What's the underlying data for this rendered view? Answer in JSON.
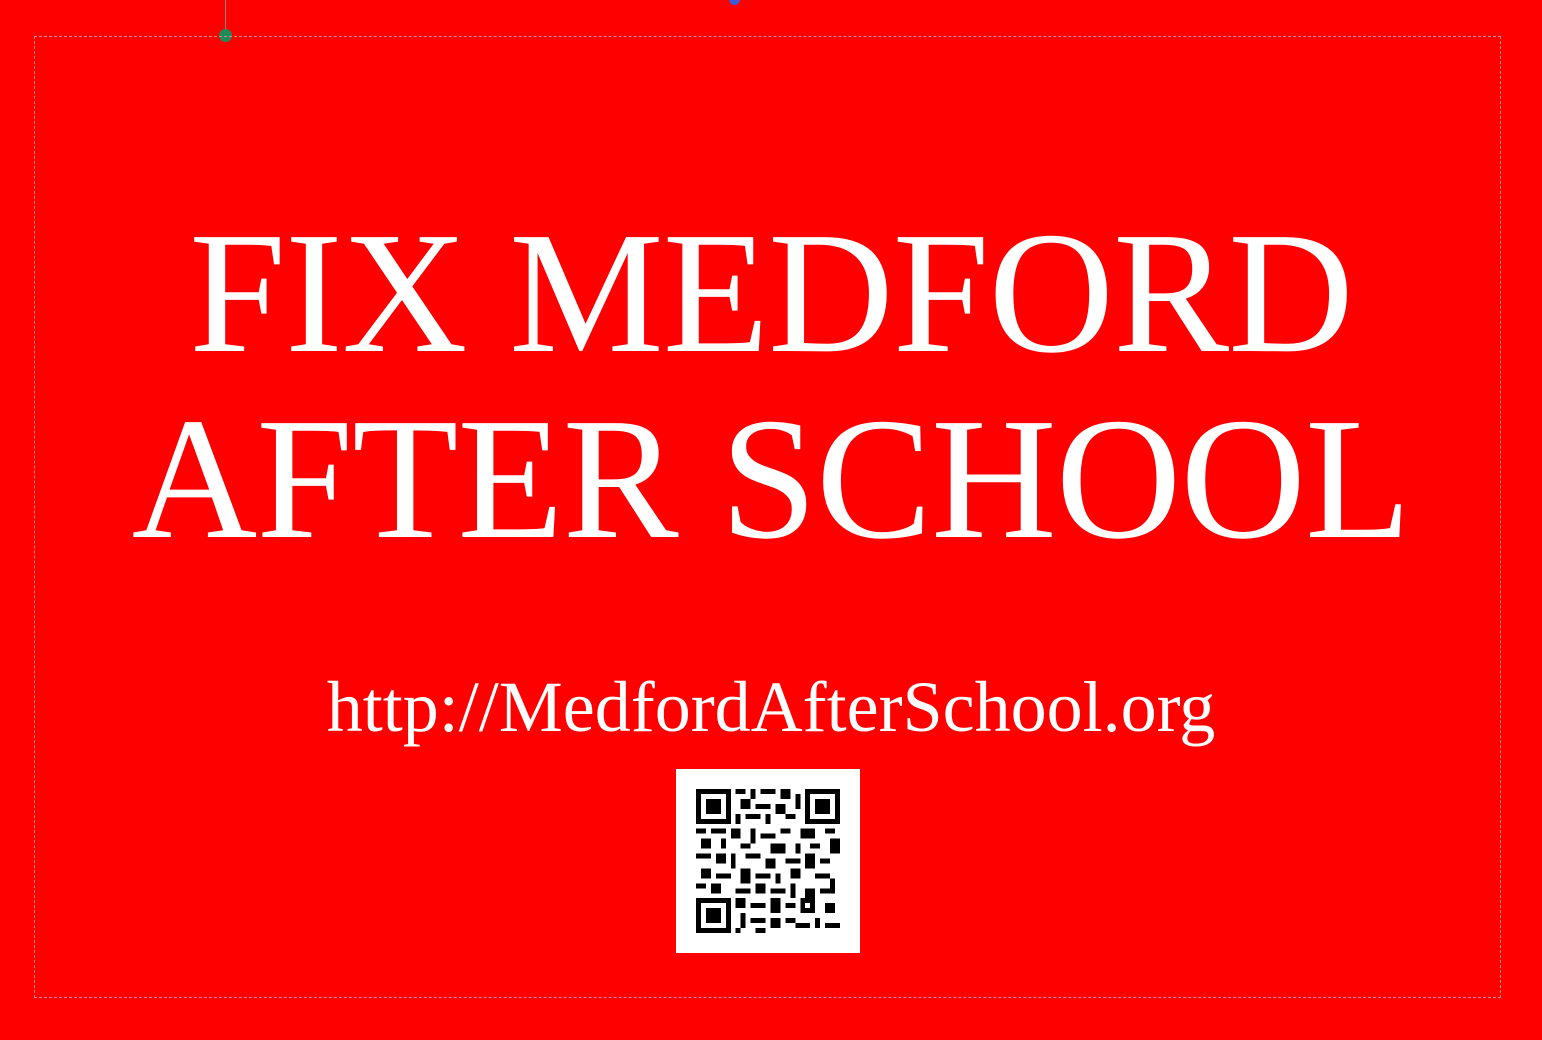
{
  "poster": {
    "headline_line1": "FIX MEDFORD",
    "headline_line2": "AFTER SCHOOL",
    "url": "http://MedfordAfterSchool.org",
    "background_color": "#ff0000",
    "text_color": "#ffffff"
  },
  "qr": {
    "icon": "qr-code-icon"
  }
}
